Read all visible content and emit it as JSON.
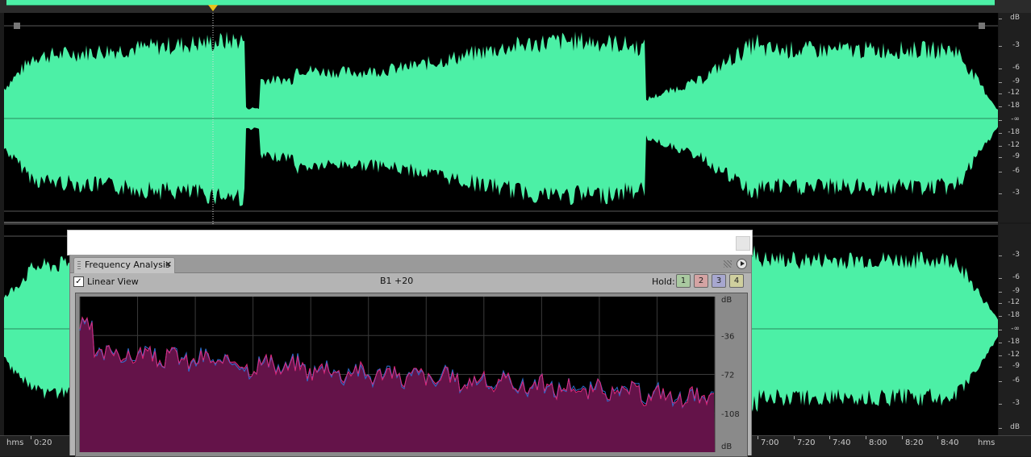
{
  "waveform": {
    "color": "#4cf0a6",
    "background": "#000000",
    "db_scale_label": "dB",
    "channel1_scale": [
      "dB",
      "-3",
      "-6",
      "-9",
      "-12",
      "-18",
      "-∞",
      "-18",
      "-12",
      "-9",
      "-6",
      "-3"
    ],
    "channel2_scale": [
      "-3",
      "-6",
      "-9",
      "-12",
      "-18",
      "-∞",
      "-18",
      "-12",
      "-9",
      "-6",
      "-3",
      "dB"
    ]
  },
  "timeline": {
    "unit_left": "hms",
    "unit_right": "hms",
    "labels": [
      "0:20",
      "7:00",
      "7:20",
      "7:40",
      "8:00",
      "8:20",
      "8:40"
    ]
  },
  "panel": {
    "tab_label": "Frequency Analysis",
    "tab_close": "×",
    "linear_view_label": "Linear View",
    "linear_view_checked": true,
    "check_glyph": "✓",
    "readout": "B1 +20",
    "hold_label": "Hold:",
    "hold_buttons": [
      {
        "label": "1",
        "color": "#a9c9a0"
      },
      {
        "label": "2",
        "color": "#d4a3a3"
      },
      {
        "label": "3",
        "color": "#a7a7cf"
      },
      {
        "label": "4",
        "color": "#cfcf9e"
      }
    ]
  },
  "chart_data": {
    "type": "area",
    "ylabel_top": "dB",
    "ylabel_bottom": "dB",
    "y_ticks": [
      "-36",
      "-72",
      "-108"
    ],
    "ylim": [
      -144,
      0
    ],
    "fill_color": "#641349",
    "line_colors": [
      "#e0287a",
      "#2e6fd0"
    ]
  }
}
